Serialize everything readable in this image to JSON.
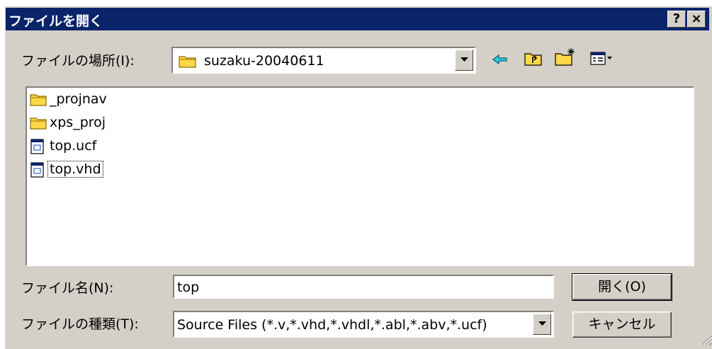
{
  "window": {
    "title": "ファイルを開く",
    "help_label": "?",
    "close_label": "×"
  },
  "location": {
    "label": "ファイルの場所(I):",
    "value": "suzaku-20040611"
  },
  "toolbar": {
    "icons": [
      "back-arrow-icon",
      "up-folder-icon",
      "new-folder-icon",
      "view-menu-icon"
    ]
  },
  "files": [
    {
      "name": "_projnav",
      "type": "folder"
    },
    {
      "name": "xps_proj",
      "type": "folder"
    },
    {
      "name": "top.ucf",
      "type": "file"
    },
    {
      "name": "top.vhd",
      "type": "file",
      "focused": true
    }
  ],
  "filename": {
    "label": "ファイル名(N):",
    "value": "top"
  },
  "filetype": {
    "label": "ファイルの種類(T):",
    "value": "Source Files (*.v,*.vhd,*.vhdl,*.abl,*.abv,*.ucf)"
  },
  "buttons": {
    "open_label": "開く(O)",
    "cancel_label": "キャンセル"
  },
  "colors": {
    "titlebar": "#0a246a",
    "face": "#d4d0c8",
    "folder": "#ffd84a"
  }
}
